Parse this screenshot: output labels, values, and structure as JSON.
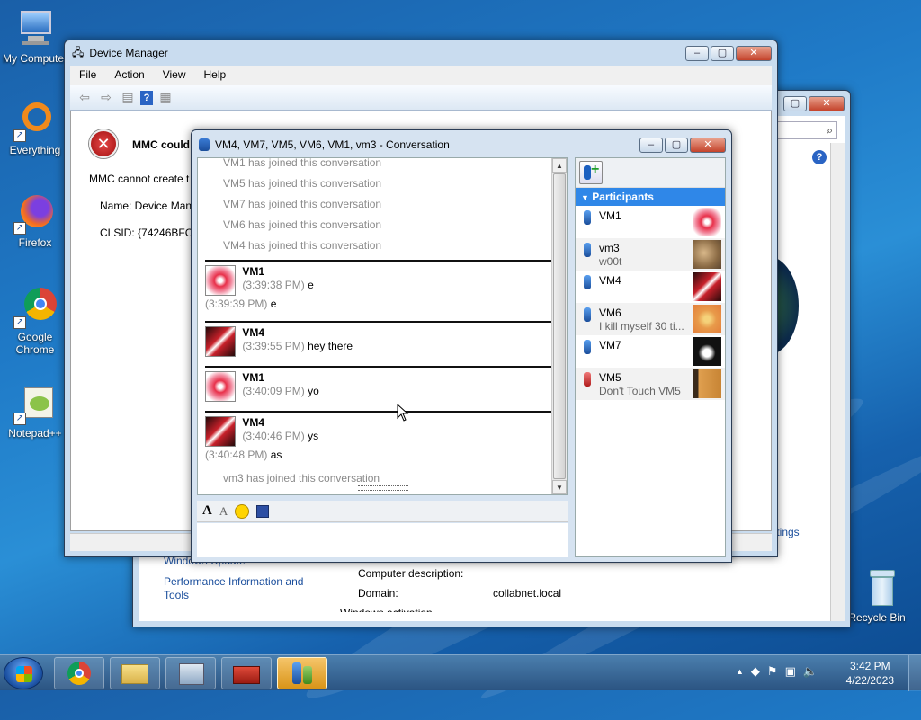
{
  "desktop": {
    "icons": [
      {
        "label": "My Computer"
      },
      {
        "label": "Everything"
      },
      {
        "label": "Firefox"
      },
      {
        "label": "Google Chrome"
      },
      {
        "label": "Notepad++"
      },
      {
        "label": "Recycle Bin"
      }
    ]
  },
  "system_window": {
    "links": [
      "Windows Update",
      "Performance Information and Tools"
    ],
    "settings_link": "ttings",
    "fields": [
      {
        "label": "Computer description:",
        "value": ""
      },
      {
        "label": "Domain:",
        "value": "collabnet.local"
      }
    ],
    "cut_heading": "Windows activation"
  },
  "device_manager": {
    "title": "Device Manager",
    "menu": [
      "File",
      "Action",
      "View",
      "Help"
    ],
    "error_title": "MMC could",
    "error_line": "MMC cannot create t",
    "name_line": "Name: Device Mana",
    "clsid_line": "CLSID: {74246BFC-4"
  },
  "conversation": {
    "title": "VM4, VM7, VM5, VM6, VM1, vm3 - Conversation",
    "join_messages": [
      "VM1 has joined this conversation",
      "VM5 has joined this conversation",
      "VM7 has joined this conversation",
      "VM6 has joined this conversation",
      "VM4 has joined this conversation"
    ],
    "messages": [
      {
        "sender": "VM1",
        "lines": [
          {
            "time": "(3:39:38 PM)",
            "text": "e",
            "indent": true
          },
          {
            "time": "(3:39:39 PM)",
            "text": "e",
            "indent": false
          }
        ]
      },
      {
        "sender": "VM4",
        "lines": [
          {
            "time": "(3:39:55 PM)",
            "text": "hey there",
            "indent": true
          }
        ]
      },
      {
        "sender": "VM1",
        "lines": [
          {
            "time": "(3:40:09 PM)",
            "text": "yo",
            "indent": true
          }
        ]
      },
      {
        "sender": "VM4",
        "lines": [
          {
            "time": "(3:40:46 PM)",
            "text": "ys",
            "indent": true
          },
          {
            "time": "(3:40:48 PM)",
            "text": "as",
            "indent": false
          }
        ]
      }
    ],
    "final_join": "vm3 has joined this conversation",
    "participants_header": "Participants",
    "participants": [
      {
        "name": "VM1",
        "status": ""
      },
      {
        "name": "vm3",
        "status": "w00t"
      },
      {
        "name": "VM4",
        "status": ""
      },
      {
        "name": "VM6",
        "status": "I kill myself 30 ti..."
      },
      {
        "name": "VM7",
        "status": ""
      },
      {
        "name": "VM5",
        "status": "Don't Touch VM5"
      }
    ]
  },
  "taskbar": {
    "time": "3:42 PM",
    "date": "4/22/2023"
  }
}
